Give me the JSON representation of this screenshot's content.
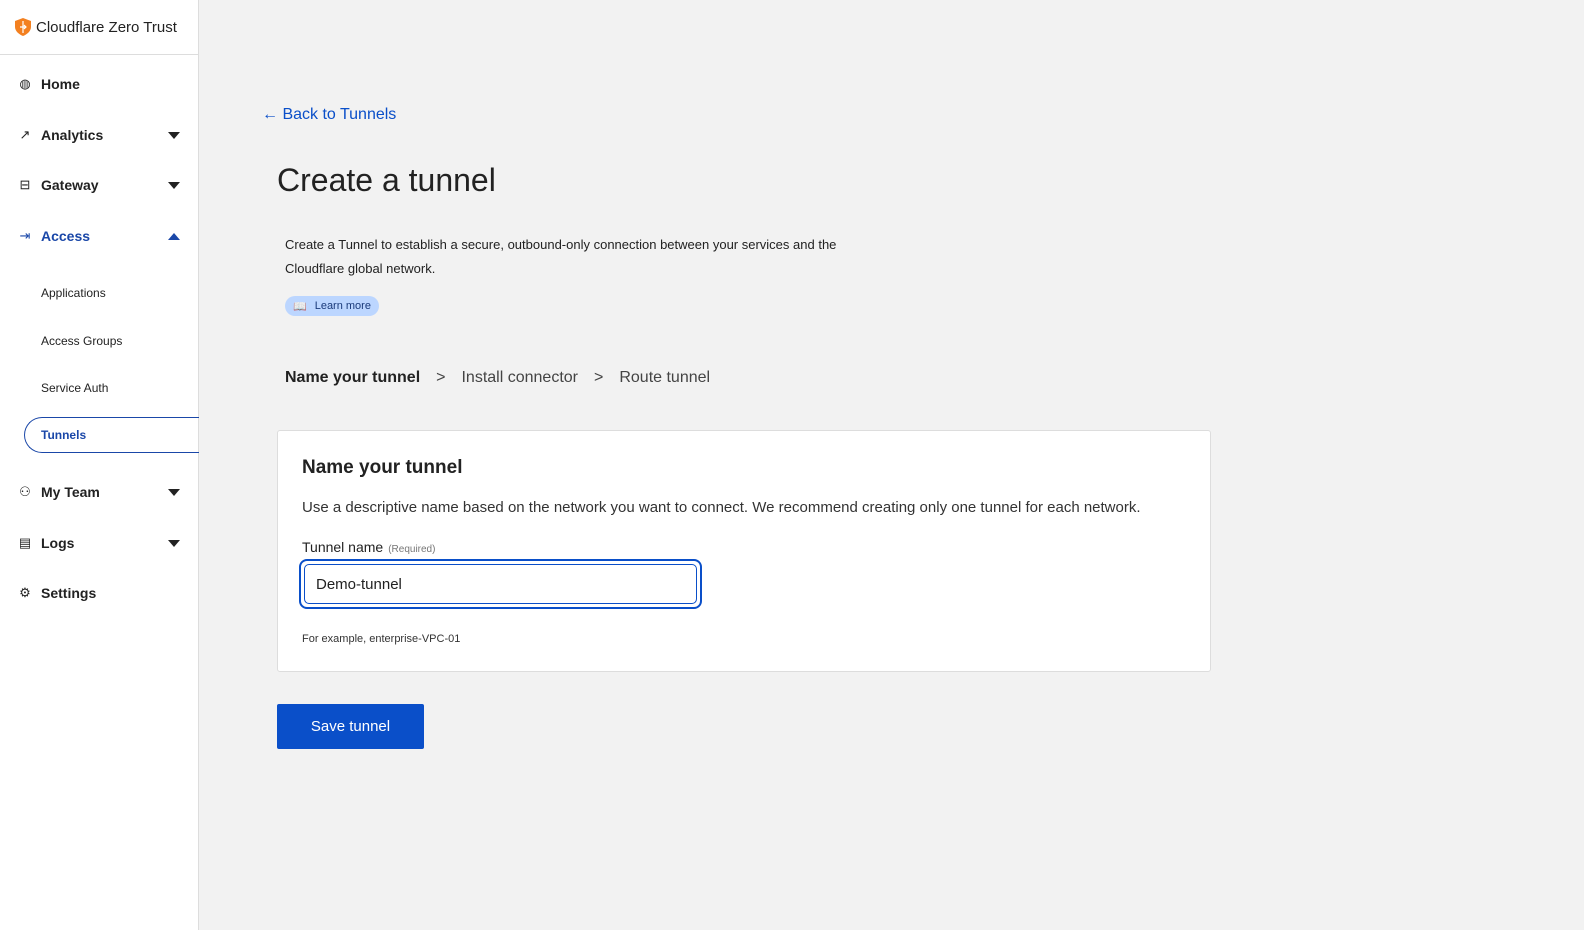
{
  "brand": "Cloudflare Zero Trust",
  "nav": {
    "home": "Home",
    "analytics": "Analytics",
    "gateway": "Gateway",
    "access": "Access",
    "my_team": "My Team",
    "logs": "Logs",
    "settings": "Settings",
    "access_sub": {
      "applications": "Applications",
      "access_groups": "Access Groups",
      "service_auth": "Service Auth",
      "tunnels": "Tunnels"
    }
  },
  "back_link": "← Back to Tunnels",
  "title": "Create a tunnel",
  "description": "Create a Tunnel to establish a secure, outbound-only connection between your services and the Cloudflare global network.",
  "learn_more": "Learn more",
  "steps": {
    "s1": "Name your tunnel",
    "sep": ">",
    "s2": "Install connector",
    "s3": "Route tunnel"
  },
  "card": {
    "title": "Name your tunnel",
    "text": "Use a descriptive name based on the network you want to connect. We recommend creating only one tunnel for each network.",
    "label": "Tunnel name",
    "required": "(Required)",
    "value": "Demo-tunnel",
    "hint": "For example, enterprise-VPC-01"
  },
  "save": "Save tunnel",
  "colors": {
    "accent": "#0a4fc9",
    "brand": "#f38020"
  }
}
